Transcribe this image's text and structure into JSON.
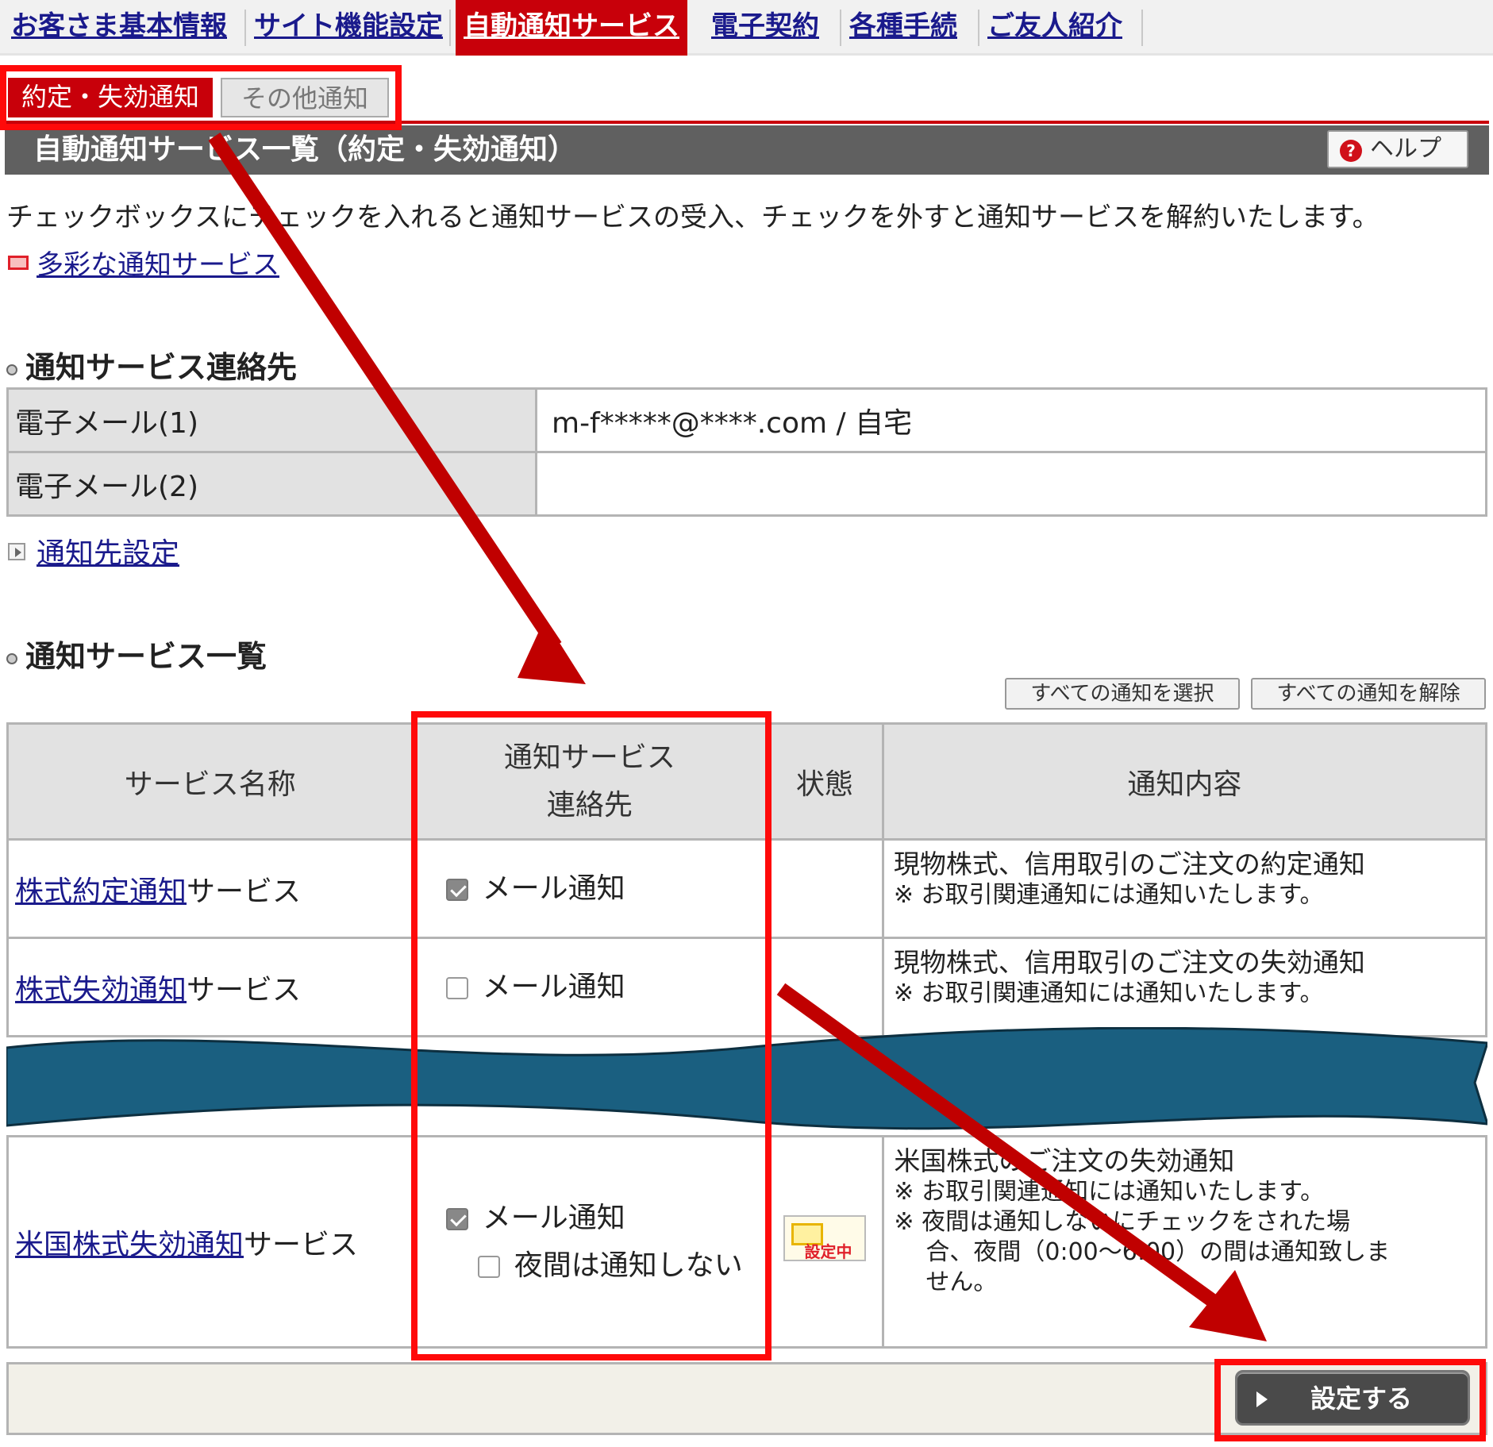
{
  "top_nav": [
    {
      "label": "お客さま基本情報",
      "active": false
    },
    {
      "label": "サイト機能設定",
      "active": false
    },
    {
      "label": "自動通知サービス",
      "active": true
    },
    {
      "label": "電子契約",
      "active": false
    },
    {
      "label": "各種手続",
      "active": false
    },
    {
      "label": "ご友人紹介",
      "active": false
    }
  ],
  "sub_tabs": [
    {
      "label": "約定・失効通知",
      "active": true
    },
    {
      "label": "その他通知",
      "active": false
    }
  ],
  "section_title": "自動通知サービス一覧（約定・失効通知）",
  "help_label": "ヘルプ",
  "description": "チェックボックスにチェックを入れると通知サービスの受入、チェックを外すと通知サービスを解約いたします。",
  "various_link": "多彩な通知サービス",
  "contact_heading": "通知サービス連絡先",
  "contacts": [
    {
      "label": "電子メール(1)",
      "value": "m-f*****@****.com / 自宅"
    },
    {
      "label": "電子メール(2)",
      "value": ""
    }
  ],
  "contact_setting_link": "通知先設定",
  "services_heading": "通知サービス一覧",
  "select_all_label": "すべての通知を選択",
  "clear_all_label": "すべての通知を解除",
  "table_headers": {
    "name": "サービス名称",
    "contact_line1": "通知サービス",
    "contact_line2": "連絡先",
    "status": "状態",
    "content": "通知内容"
  },
  "services": [
    {
      "name_link": "株式約定通知",
      "name_suffix": "サービス",
      "mail_label": "メール通知",
      "mail_checked": true,
      "content_main": "現物株式、信用取引のご注文の約定通知",
      "content_note": "※ お取引関連通知には通知いたします。"
    },
    {
      "name_link": "株式失効通知",
      "name_suffix": "サービス",
      "mail_label": "メール通知",
      "mail_checked": false,
      "content_main": "現物株式、信用取引のご注文の失効通知",
      "content_note": "※ お取引関連通知には通知いたします。"
    },
    {
      "name_link": "米国株式失効通知",
      "name_suffix": "サービス",
      "mail_label": "メール通知",
      "mail_checked": true,
      "night_label": "夜間は通知しない",
      "night_checked": false,
      "status_badge": "設定中",
      "content_main": "米国株式のご注文の失効通知",
      "content_note": "※ お取引関連通知には通知いたします。",
      "content_note2": "※ 夜間は通知しないにチェックをされた場",
      "content_note3": "合、夜間（0:00〜6:00）の間は通知致しま",
      "content_note4": "せん。"
    }
  ],
  "submit_label": "設定する",
  "colors": {
    "accent_red": "#c8000a",
    "annotation_red": "#ff0a0a",
    "wave_blue": "#1a5f80",
    "arrow_red": "#c00000"
  }
}
